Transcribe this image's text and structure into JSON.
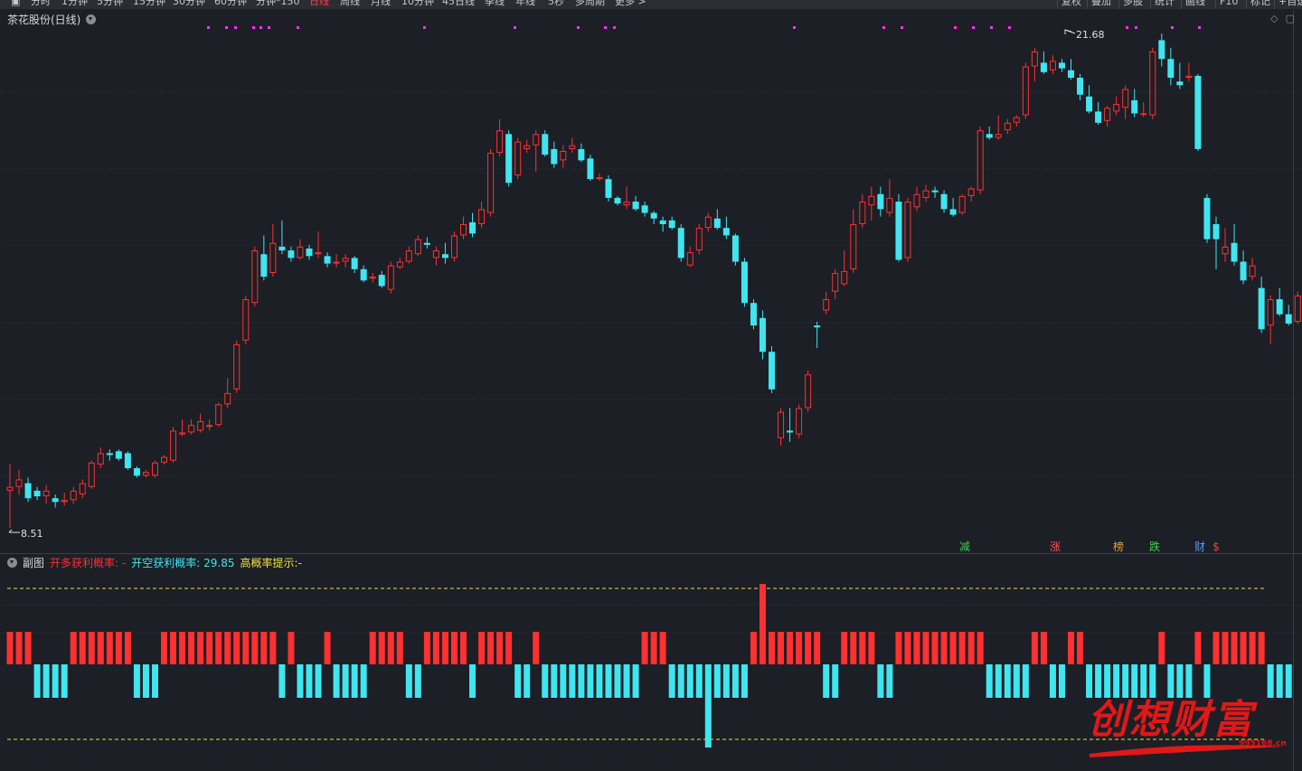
{
  "toolbar": {
    "items": [
      "分时",
      "1分钟",
      "5分钟",
      "15分钟",
      "30分钟",
      "60分钟",
      "分钟*150",
      "日线",
      "周线",
      "月线",
      "10分钟",
      "45日线",
      "季线",
      "年线",
      "5秒",
      "多周期",
      "更多 >"
    ],
    "active": "日线",
    "right_items": [
      "复权",
      "叠加",
      "多股",
      "统计",
      "画线",
      "F10",
      "标记",
      "+自选"
    ]
  },
  "main": {
    "title": "茶花股份(日线)",
    "high_label": "21.68",
    "low_label": "8.51"
  },
  "event_markers": [
    {
      "label": "减",
      "color": "#3cd24a"
    },
    {
      "label": "涨",
      "color": "#ff5050"
    },
    {
      "label": "榜",
      "color": "#f0a030"
    },
    {
      "label": "跌",
      "color": "#3cd24a"
    },
    {
      "label": "财",
      "color": "#4aa0ff"
    },
    {
      "label": "$",
      "color": "#ff4040"
    }
  ],
  "sub": {
    "title": "副图",
    "long_label": "开多获利概率:",
    "long_value": "-",
    "short_label": "开空获利概率:",
    "short_value": "29.85",
    "tip_label": "高概率提示:",
    "tip_value": "-"
  },
  "watermark": {
    "text": "创想财富",
    "url": "995168.cn"
  },
  "colors": {
    "up": "#ff3030",
    "down": "#3ee6f0",
    "background": "#1c1f26",
    "grid": "#2f333b",
    "dashed": "#f0e040",
    "marker": "#ff30ff"
  },
  "price_range": {
    "min": 8.51,
    "max": 21.68
  },
  "candles": [
    [
      9.5,
      10.2,
      8.51,
      9.6
    ],
    [
      9.6,
      10.05,
      9.4,
      9.8
    ],
    [
      9.7,
      9.85,
      9.2,
      9.3
    ],
    [
      9.5,
      9.6,
      9.25,
      9.35
    ],
    [
      9.35,
      9.65,
      9.15,
      9.5
    ],
    [
      9.3,
      9.4,
      9.05,
      9.2
    ],
    [
      9.2,
      9.45,
      9.1,
      9.25
    ],
    [
      9.25,
      9.6,
      9.15,
      9.5
    ],
    [
      9.4,
      9.8,
      9.3,
      9.7
    ],
    [
      9.6,
      10.3,
      9.55,
      10.25
    ],
    [
      10.2,
      10.65,
      10.1,
      10.5
    ],
    [
      10.5,
      10.6,
      10.3,
      10.45
    ],
    [
      10.55,
      10.6,
      10.3,
      10.35
    ],
    [
      10.5,
      10.55,
      10.05,
      10.1
    ],
    [
      10.1,
      10.15,
      9.85,
      9.9
    ],
    [
      9.9,
      10.05,
      9.85,
      10.0
    ],
    [
      9.9,
      10.3,
      9.85,
      10.25
    ],
    [
      10.25,
      10.45,
      10.2,
      10.4
    ],
    [
      10.3,
      11.2,
      10.25,
      11.1
    ],
    [
      11.0,
      11.4,
      10.95,
      11.05
    ],
    [
      11.05,
      11.4,
      11.0,
      11.25
    ],
    [
      11.1,
      11.55,
      11.05,
      11.35
    ],
    [
      11.2,
      11.4,
      11.1,
      11.25
    ],
    [
      11.25,
      11.85,
      11.2,
      11.8
    ],
    [
      11.8,
      12.5,
      11.7,
      12.1
    ],
    [
      12.2,
      13.5,
      12.1,
      13.4
    ],
    [
      13.5,
      14.7,
      13.4,
      14.6
    ],
    [
      14.5,
      16.0,
      14.4,
      15.9
    ],
    [
      15.8,
      16.3,
      15.1,
      15.2
    ],
    [
      15.3,
      16.6,
      15.2,
      16.1
    ],
    [
      16.0,
      16.7,
      15.8,
      15.9
    ],
    [
      15.9,
      16.0,
      15.6,
      15.7
    ],
    [
      15.7,
      16.2,
      15.65,
      16.0
    ],
    [
      15.95,
      16.05,
      15.65,
      15.75
    ],
    [
      15.8,
      16.4,
      15.7,
      15.85
    ],
    [
      15.75,
      15.85,
      15.45,
      15.55
    ],
    [
      15.55,
      15.8,
      15.45,
      15.6
    ],
    [
      15.6,
      15.8,
      15.45,
      15.7
    ],
    [
      15.7,
      15.75,
      15.3,
      15.4
    ],
    [
      15.4,
      15.5,
      15.05,
      15.1
    ],
    [
      15.15,
      15.3,
      15.05,
      15.2
    ],
    [
      15.25,
      15.35,
      14.9,
      14.95
    ],
    [
      14.85,
      15.6,
      14.75,
      15.5
    ],
    [
      15.45,
      15.7,
      15.4,
      15.6
    ],
    [
      15.6,
      16.0,
      15.55,
      15.9
    ],
    [
      15.8,
      16.3,
      15.75,
      16.2
    ],
    [
      16.1,
      16.25,
      15.95,
      16.05
    ],
    [
      15.7,
      16.0,
      15.5,
      15.9
    ],
    [
      15.8,
      16.1,
      15.55,
      15.7
    ],
    [
      15.7,
      16.4,
      15.6,
      16.3
    ],
    [
      16.3,
      16.8,
      16.2,
      16.6
    ],
    [
      16.65,
      16.9,
      16.25,
      16.35
    ],
    [
      16.6,
      17.2,
      16.5,
      17.0
    ],
    [
      16.9,
      18.6,
      16.8,
      18.5
    ],
    [
      18.5,
      19.4,
      18.4,
      19.1
    ],
    [
      19.0,
      19.1,
      17.6,
      17.7
    ],
    [
      17.9,
      18.9,
      17.8,
      18.8
    ],
    [
      18.6,
      18.85,
      18.5,
      18.7
    ],
    [
      18.7,
      19.1,
      18.0,
      19.0
    ],
    [
      19.0,
      19.1,
      18.4,
      18.45
    ],
    [
      18.6,
      18.8,
      18.1,
      18.2
    ],
    [
      18.3,
      18.7,
      18.1,
      18.55
    ],
    [
      18.6,
      18.9,
      18.5,
      18.7
    ],
    [
      18.6,
      18.75,
      18.25,
      18.3
    ],
    [
      18.35,
      18.45,
      17.75,
      17.8
    ],
    [
      17.8,
      17.95,
      17.75,
      17.85
    ],
    [
      17.8,
      17.9,
      17.2,
      17.3
    ],
    [
      17.3,
      17.35,
      17.1,
      17.15
    ],
    [
      17.1,
      17.6,
      17.0,
      17.2
    ],
    [
      17.2,
      17.35,
      16.95,
      17.0
    ],
    [
      17.1,
      17.2,
      16.8,
      16.9
    ],
    [
      16.9,
      16.95,
      16.6,
      16.75
    ],
    [
      16.7,
      16.8,
      16.4,
      16.6
    ],
    [
      16.7,
      16.8,
      16.45,
      16.5
    ],
    [
      16.5,
      16.6,
      15.6,
      15.7
    ],
    [
      15.5,
      16.0,
      15.45,
      15.85
    ],
    [
      15.9,
      16.6,
      15.8,
      16.5
    ],
    [
      16.5,
      16.9,
      16.4,
      16.8
    ],
    [
      16.75,
      17.0,
      16.45,
      16.5
    ],
    [
      16.5,
      16.8,
      16.2,
      16.3
    ],
    [
      16.3,
      16.35,
      15.5,
      15.6
    ],
    [
      15.6,
      15.7,
      14.4,
      14.5
    ],
    [
      14.5,
      14.6,
      13.8,
      13.9
    ],
    [
      14.1,
      14.3,
      13.0,
      13.2
    ],
    [
      13.2,
      13.35,
      12.1,
      12.2
    ],
    [
      10.9,
      11.7,
      10.7,
      11.6
    ],
    [
      11.1,
      11.7,
      10.8,
      11.05
    ],
    [
      11.0,
      11.8,
      10.9,
      11.7
    ],
    [
      11.7,
      12.7,
      11.6,
      12.6
    ],
    [
      13.9,
      14.0,
      13.3,
      13.85
    ],
    [
      14.3,
      14.8,
      14.2,
      14.6
    ],
    [
      14.8,
      15.4,
      14.6,
      15.3
    ],
    [
      15.0,
      15.9,
      14.95,
      15.35
    ],
    [
      15.4,
      17.0,
      15.3,
      16.6
    ],
    [
      16.6,
      17.4,
      16.5,
      17.2
    ],
    [
      17.1,
      17.6,
      16.7,
      17.35
    ],
    [
      17.4,
      17.6,
      16.8,
      17.0
    ],
    [
      16.9,
      17.8,
      16.8,
      17.3
    ],
    [
      17.2,
      17.4,
      15.6,
      15.65
    ],
    [
      15.7,
      17.3,
      15.6,
      17.2
    ],
    [
      17.05,
      17.6,
      16.95,
      17.4
    ],
    [
      17.3,
      17.65,
      17.2,
      17.5
    ],
    [
      17.5,
      17.6,
      17.3,
      17.45
    ],
    [
      17.4,
      17.5,
      16.9,
      17.0
    ],
    [
      17.0,
      17.3,
      16.8,
      16.85
    ],
    [
      16.9,
      17.4,
      16.85,
      17.35
    ],
    [
      17.35,
      17.6,
      17.2,
      17.55
    ],
    [
      17.5,
      19.2,
      17.4,
      19.1
    ],
    [
      19.0,
      19.2,
      18.85,
      18.9
    ],
    [
      18.9,
      19.5,
      18.85,
      19.0
    ],
    [
      19.1,
      19.4,
      19.0,
      19.3
    ],
    [
      19.3,
      19.5,
      19.2,
      19.45
    ],
    [
      19.5,
      20.9,
      19.4,
      20.8
    ],
    [
      20.8,
      21.3,
      20.4,
      21.2
    ],
    [
      20.9,
      21.2,
      20.6,
      20.65
    ],
    [
      20.7,
      21.1,
      20.6,
      20.95
    ],
    [
      20.9,
      21.0,
      20.65,
      20.75
    ],
    [
      20.7,
      21.0,
      20.45,
      20.5
    ],
    [
      20.5,
      20.6,
      19.9,
      20.05
    ],
    [
      20.0,
      20.3,
      19.55,
      19.6
    ],
    [
      19.6,
      19.85,
      19.25,
      19.3
    ],
    [
      19.35,
      19.75,
      19.2,
      19.7
    ],
    [
      19.6,
      20.0,
      19.5,
      19.8
    ],
    [
      19.7,
      20.3,
      19.4,
      20.2
    ],
    [
      19.9,
      20.2,
      19.45,
      19.55
    ],
    [
      19.55,
      19.85,
      19.45,
      19.55
    ],
    [
      19.5,
      21.3,
      19.4,
      21.2
    ],
    [
      21.5,
      21.68,
      20.8,
      21.0
    ],
    [
      21.0,
      21.3,
      20.3,
      20.5
    ],
    [
      20.4,
      20.9,
      20.2,
      20.3
    ],
    [
      20.5,
      20.9,
      20.4,
      20.55
    ],
    [
      20.55,
      20.6,
      18.55,
      18.6
    ],
    [
      17.3,
      17.4,
      16.1,
      16.2
    ],
    [
      16.6,
      16.8,
      15.4,
      16.2
    ],
    [
      15.8,
      16.5,
      15.6,
      16.0
    ],
    [
      16.1,
      16.6,
      15.5,
      15.6
    ],
    [
      15.6,
      15.9,
      15.0,
      15.1
    ],
    [
      15.2,
      15.7,
      15.1,
      15.5
    ],
    [
      14.9,
      15.2,
      13.7,
      13.8
    ],
    [
      13.9,
      14.7,
      13.4,
      14.6
    ],
    [
      14.6,
      14.9,
      14.15,
      14.2
    ],
    [
      14.2,
      14.45,
      13.9,
      13.95
    ],
    [
      14.0,
      14.8,
      13.95,
      14.7
    ],
    [
      14.6,
      15.2,
      14.5,
      14.9
    ],
    [
      14.7,
      15.4,
      14.65,
      15.3
    ],
    [
      15.4,
      16.0,
      15.3,
      15.9
    ],
    [
      15.9,
      16.3,
      15.55,
      15.6
    ],
    [
      15.6,
      15.9,
      15.4,
      15.8
    ],
    [
      15.4,
      15.9,
      15.3,
      15.85
    ],
    [
      15.9,
      16.0,
      15.2,
      15.3
    ],
    [
      14.9,
      15.1,
      14.8,
      15.0
    ],
    [
      15.1,
      15.3,
      14.85,
      15.3
    ]
  ],
  "sub_bars": [
    1,
    1,
    1,
    -1,
    -1,
    -1,
    -1,
    1,
    1,
    1,
    1,
    1,
    1,
    1,
    -1,
    -1,
    -1,
    1,
    1,
    1,
    1,
    1,
    1,
    1,
    1,
    1,
    1,
    1,
    1,
    1,
    -1,
    1,
    -1,
    -1,
    -1,
    1,
    -1,
    -1,
    -1,
    -1,
    1,
    1,
    1,
    1,
    -1,
    -1,
    1,
    1,
    1,
    1,
    1,
    -1,
    1,
    1,
    1,
    1,
    -1,
    -1,
    1,
    -1,
    -1,
    -1,
    -1,
    -1,
    -1,
    -1,
    -1,
    -1,
    -1,
    -1,
    1,
    1,
    1,
    -1,
    -1,
    -1,
    -1,
    -1,
    -1,
    -1,
    -1,
    -1,
    1,
    2,
    1,
    1,
    1,
    1,
    1,
    1,
    -1,
    -1,
    1,
    1,
    1,
    1,
    -1,
    -1,
    1,
    1,
    1,
    1,
    1,
    1,
    1,
    1,
    1,
    1,
    -1,
    -1,
    -1,
    -1,
    -1,
    1,
    1,
    -1,
    -1,
    1,
    1,
    -1,
    -1,
    -1,
    -1,
    -1,
    -1,
    -1,
    -1,
    1,
    -1,
    -1,
    -1,
    1,
    -1,
    1,
    1,
    1,
    1,
    1,
    1,
    -1,
    -1,
    -1
  ]
}
